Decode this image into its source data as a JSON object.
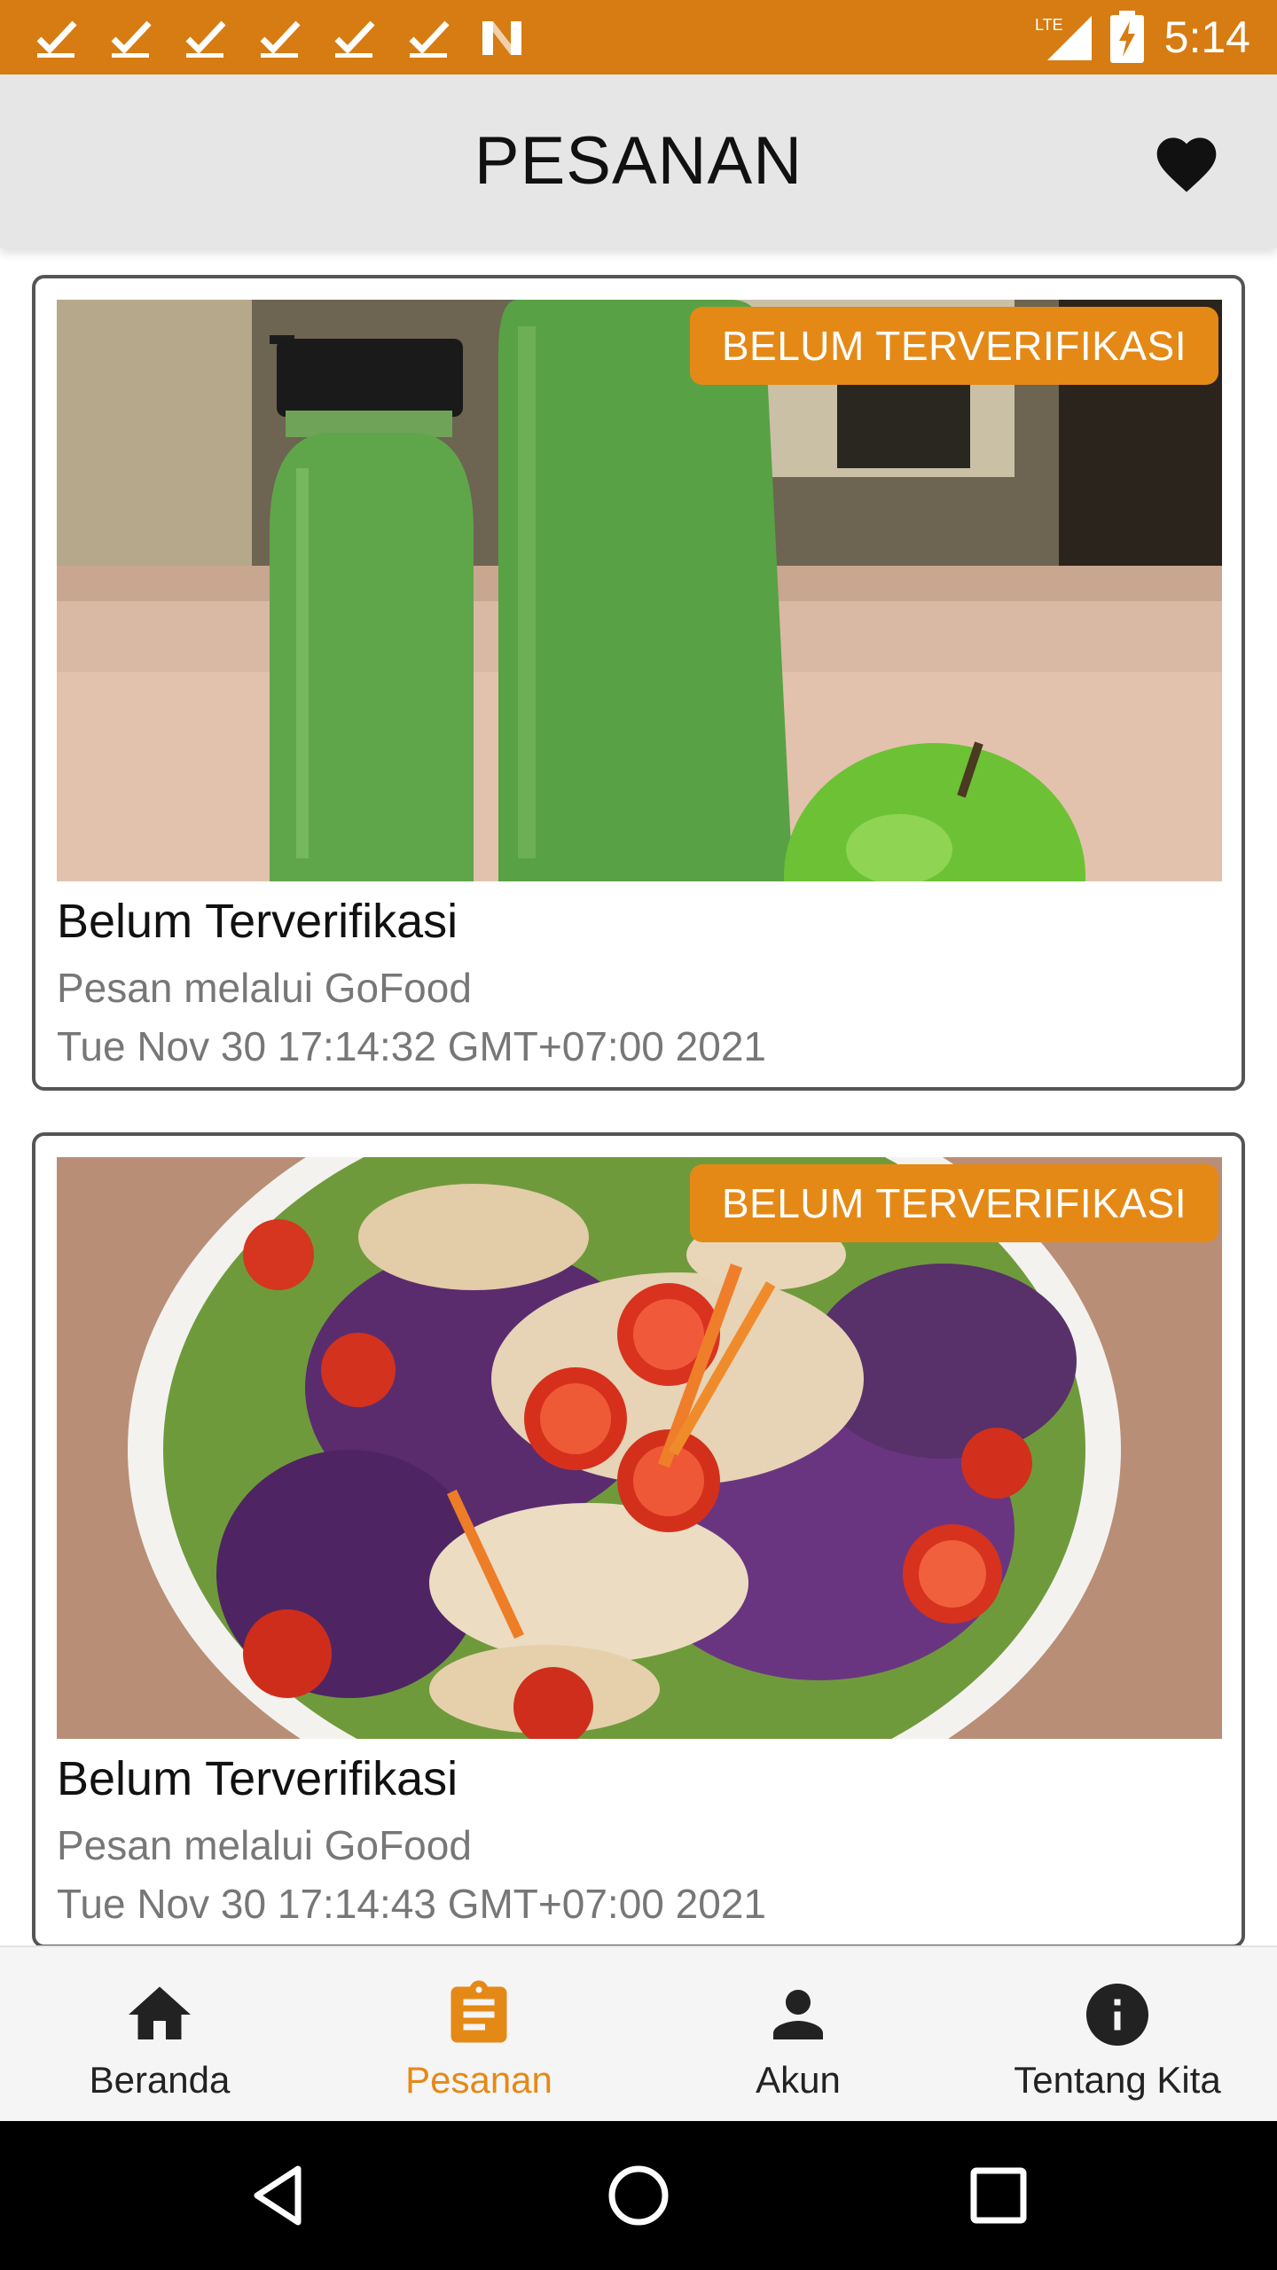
{
  "status_bar": {
    "time": "5:14",
    "network": "LTE",
    "notification_icons": [
      "check-icon",
      "check-icon",
      "check-icon",
      "check-icon",
      "check-icon",
      "check-icon",
      "n-logo-icon"
    ]
  },
  "app_bar": {
    "title": "PESANAN",
    "action_icon": "heart-icon"
  },
  "orders": [
    {
      "badge": "BELUM TERVERIFIKASI",
      "status": "Belum Terverifikasi",
      "channel": "Pesan melalui GoFood",
      "date": "Tue Nov 30 17:14:32 GMT+07:00 2021",
      "image": "green-juice-bottles-photo"
    },
    {
      "badge": "BELUM TERVERIFIKASI",
      "status": "Belum Terverifikasi",
      "channel": "Pesan melalui GoFood",
      "date": "Tue Nov 30 17:14:43 GMT+07:00 2021",
      "image": "chicken-salad-photo"
    }
  ],
  "bottom_nav": {
    "items": [
      {
        "label": "Beranda",
        "icon": "home-icon",
        "active": false
      },
      {
        "label": "Pesanan",
        "icon": "clipboard-icon",
        "active": true
      },
      {
        "label": "Akun",
        "icon": "person-icon",
        "active": false
      },
      {
        "label": "Tentang Kita",
        "icon": "info-icon",
        "active": false
      }
    ]
  },
  "colors": {
    "accent": "#e58916",
    "status_bar": "#d67c12",
    "app_bar": "#e6e6e6",
    "text_secondary": "#777777"
  },
  "system_nav": {
    "buttons": [
      "back-icon",
      "home-circle-icon",
      "recents-icon"
    ]
  }
}
